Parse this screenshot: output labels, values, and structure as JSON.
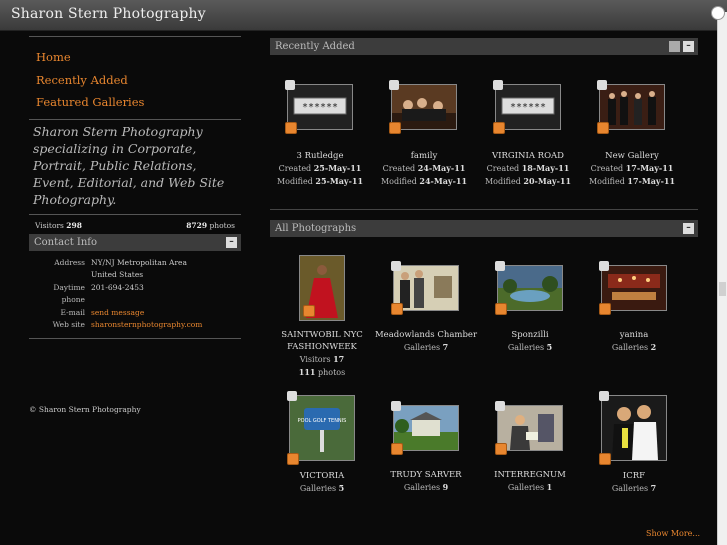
{
  "window": {
    "title": "Sharon Stern Photography"
  },
  "sidebar": {
    "nav": [
      {
        "label": "Home"
      },
      {
        "label": "Recently Added"
      },
      {
        "label": "Featured Galleries"
      }
    ],
    "tagline": "Sharon Stern Photography specializing in Corporate, Portrait, Public Relations, Event, Editorial, and Web Site Photography.",
    "stats": {
      "visitors_label": "Visitors",
      "visitors": "298",
      "photos": "8729",
      "photos_label": "photos"
    },
    "contact": {
      "title": "Contact Info",
      "collapse": "–",
      "rows": [
        {
          "key": "Address",
          "value": "NY/NJ Metropolitan Area"
        },
        {
          "key": "",
          "value": "United States"
        },
        {
          "key": "Daytime phone",
          "value": "201-694-2453"
        },
        {
          "key": "E-mail",
          "value": "send message"
        },
        {
          "key": "Web site",
          "value": "sharonsternphotography.com"
        }
      ]
    },
    "copyright": "© Sharon Stern Photography"
  },
  "recent": {
    "title": "Recently Added",
    "collapse": "–",
    "items": [
      {
        "title": "3 Rutledge",
        "created_label": "Created",
        "created": "25-May-11",
        "modified_label": "Modified",
        "modified": "25-May-11",
        "thumb": "password"
      },
      {
        "title": "family",
        "created_label": "Created",
        "created": "24-May-11",
        "modified_label": "Modified",
        "modified": "24-May-11",
        "thumb": "photo"
      },
      {
        "title": "VIRGINIA ROAD",
        "created_label": "Created",
        "created": "18-May-11",
        "modified_label": "Modified",
        "modified": "20-May-11",
        "thumb": "password"
      },
      {
        "title": "New Gallery",
        "created_label": "Created",
        "created": "17-May-11",
        "modified_label": "Modified",
        "modified": "17-May-11",
        "thumb": "photo"
      }
    ]
  },
  "all": {
    "title": "All Photographs",
    "collapse": "–",
    "items": [
      {
        "title": "SAINTWOBIL NYC FASHIONWEEK",
        "line1_label": "Visitors",
        "line1": "17",
        "line2": "111",
        "line2_label": "photos"
      },
      {
        "title": "Meadowlands Chamber",
        "line1_label": "Galleries",
        "line1": "7"
      },
      {
        "title": "Sponzilli",
        "line1_label": "Galleries",
        "line1": "5"
      },
      {
        "title": "yanina",
        "line1_label": "Galleries",
        "line1": "2"
      },
      {
        "title": "VICTORIA",
        "line1_label": "Galleries",
        "line1": "5"
      },
      {
        "title": "TRUDY SARVER",
        "line1_label": "Galleries",
        "line1": "9"
      },
      {
        "title": "INTERREGNUM",
        "line1_label": "Galleries",
        "line1": "1"
      },
      {
        "title": "ICRF",
        "line1_label": "Galleries",
        "line1": "7"
      }
    ],
    "password_mask": "******",
    "sign_text": "POOL GOLF TENNIS",
    "show_more": "Show More..."
  },
  "colors": {
    "accent": "#e8862f",
    "background": "#000000",
    "panel": "#3c3c3c"
  }
}
